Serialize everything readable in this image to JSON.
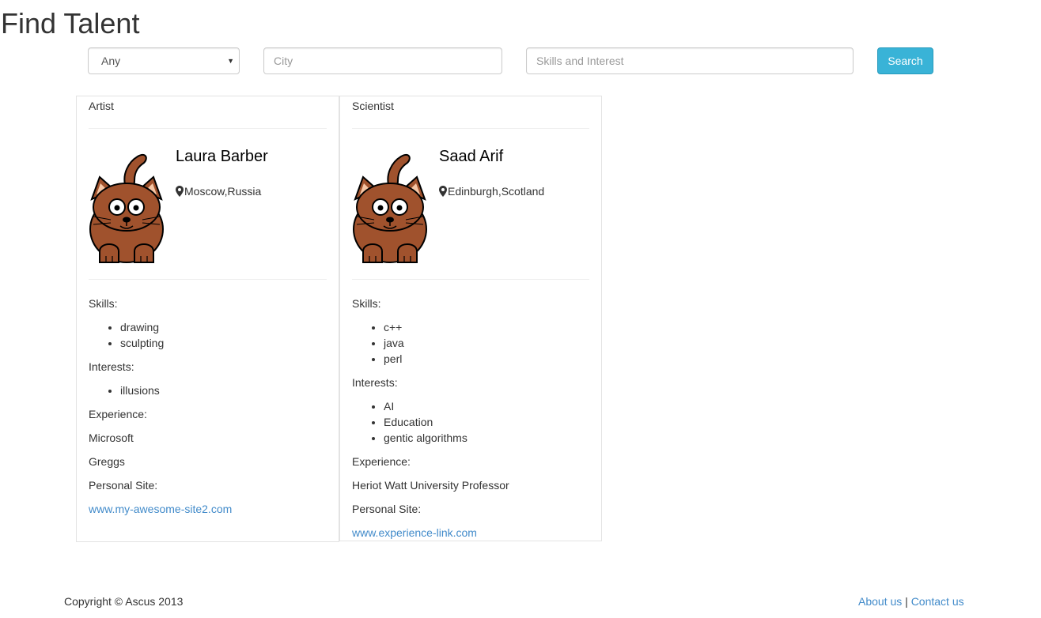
{
  "page": {
    "title": "Find Talent"
  },
  "search": {
    "category_selected": "Any",
    "city_placeholder": "City",
    "skills_placeholder": "Skills and Interest",
    "button_label": "Search"
  },
  "labels": {
    "skills": "Skills:",
    "interests": "Interests:",
    "experience": "Experience:",
    "personal_site": "Personal Site:"
  },
  "profiles": [
    {
      "category": "Artist",
      "name": "Laura Barber",
      "location": "Moscow,Russia",
      "skills": [
        "drawing",
        "sculpting"
      ],
      "interests": [
        "illusions"
      ],
      "experience": [
        "Microsoft",
        "Greggs"
      ],
      "site": "www.my-awesome-site2.com"
    },
    {
      "category": "Scientist",
      "name": "Saad Arif",
      "location": "Edinburgh,Scotland",
      "skills": [
        "c++",
        "java",
        "perl"
      ],
      "interests": [
        "AI",
        "Education",
        "gentic algorithms"
      ],
      "experience": [
        "Heriot Watt University Professor"
      ],
      "site": "www.experience-link.com"
    }
  ],
  "footer": {
    "copyright": "Copyright © Ascus 2013",
    "about": "About us",
    "separator": "|",
    "contact": "Contact us"
  },
  "icons": {
    "avatar": "cat-avatar-icon",
    "location": "map-marker-icon",
    "dropdown": "caret-down-icon"
  },
  "colors": {
    "primary_button": "#39b3d7",
    "link": "#428bca",
    "avatar_fur": "#a0522d"
  }
}
